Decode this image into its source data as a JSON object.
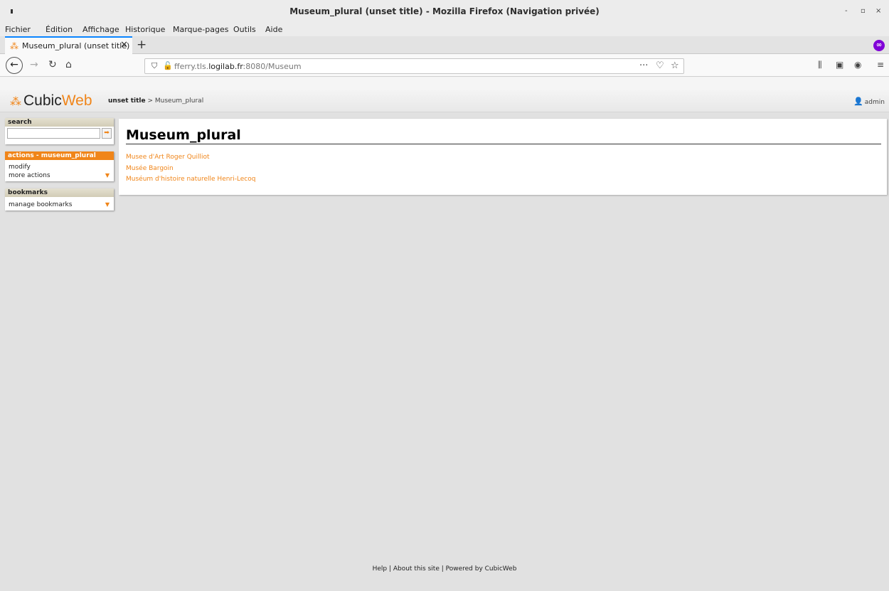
{
  "window": {
    "title": "Museum_plural (unset title) - Mozilla Firefox (Navigation privée)",
    "minimize": "-",
    "maximize": "▫",
    "close": "×"
  },
  "menu": [
    "Fichier",
    "Édition",
    "Affichage",
    "Historique",
    "Marque-pages",
    "Outils",
    "Aide"
  ],
  "tab": {
    "label": "Museum_plural (unset title)",
    "close": "✕",
    "new_tab": "+"
  },
  "nav": {
    "url_host_prefix": "fferry.tls.",
    "url_host_domain": "logilab.fr",
    "url_rest": ":8080/Museum",
    "page_actions": "···"
  },
  "site": {
    "logo_c": "Cubic",
    "logo_w": "Web",
    "breadcrumb_root": "unset title",
    "breadcrumb_sep": ">",
    "breadcrumb_current": "Museum_plural",
    "user": "admin"
  },
  "search_box": {
    "title": "search",
    "value": "",
    "button": "➡"
  },
  "actions_box": {
    "title": "actions - museum_plural",
    "items": [
      "modify",
      "more actions"
    ]
  },
  "bookmarks_box": {
    "title": "bookmarks",
    "items": [
      "manage bookmarks"
    ]
  },
  "main": {
    "heading": "Museum_plural",
    "links": [
      "Musee d'Art Roger Quilliot",
      "Musée Bargoin",
      "Muséum d'histoire naturelle Henri-Lecoq"
    ]
  },
  "footer": "Help | About this site | Powered by CubicWeb",
  "colors": {
    "accent": "#f08519",
    "private": "#8000d7",
    "tab_highlight": "#0a84ff"
  }
}
